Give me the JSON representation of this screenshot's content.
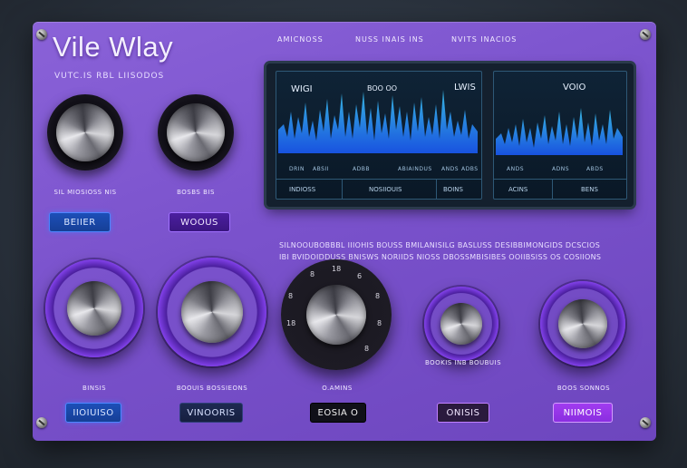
{
  "app": {
    "title": "Vile Wlay",
    "subtitle": "VUTC.IS RBL LIISODOS",
    "header_labels": [
      "AMICNOSS",
      "NUSS INAIS INS",
      "NVITS INACIOS"
    ]
  },
  "knobs_top": [
    {
      "label": "SIL MIOSIOSS NIS"
    },
    {
      "label": "BOSBS BIS"
    }
  ],
  "buttons_top": [
    {
      "label": "BEIIER"
    },
    {
      "label": "WOOUS"
    }
  ],
  "screen": {
    "left": {
      "title_left": "WIGI",
      "title_mid": "BOO OO",
      "title_right": "LWIS",
      "axis_labels": [
        "DRIN",
        "ABSII",
        "ADBB",
        "ABIAINDUS",
        "ANDS",
        "ADBS"
      ],
      "footer": [
        "INDIOSS",
        "NOSIIOUIS",
        "BOINS"
      ]
    },
    "right": {
      "title": "VOIO",
      "axis_labels": [
        "ANDS",
        "ADNS",
        "ABDS"
      ],
      "footer": [
        "ACINS",
        "BENS"
      ]
    }
  },
  "description": {
    "line1": "SILNOOUBOBBBL IIIOHIS BOUSS BMILANISILG BASLUSS DESIBBIMONGIDS DCSCIOS",
    "line2": "IBI BVIDOIDDUSS BNISWS NORIIDS NIOSS DBOSSMBISIBES OOIIBSISS OS COSIIONS"
  },
  "knobs_bottom": [
    {
      "label": "BINSIS",
      "button": "IIOIUISO"
    },
    {
      "label": "BOOUIS BOSSIEONS",
      "button": "VINOORIS"
    },
    {
      "label": "O.AMINS",
      "button": "EOSIA O",
      "dial_ticks": [
        "8",
        "18",
        "6",
        "8",
        "8",
        "8",
        "18",
        "8"
      ]
    },
    {
      "label": "BOOKIS INB BOUBUIS",
      "button": "ONISIS"
    },
    {
      "label": "BOOS SONNOS",
      "button": "NIIMOIS"
    }
  ]
}
